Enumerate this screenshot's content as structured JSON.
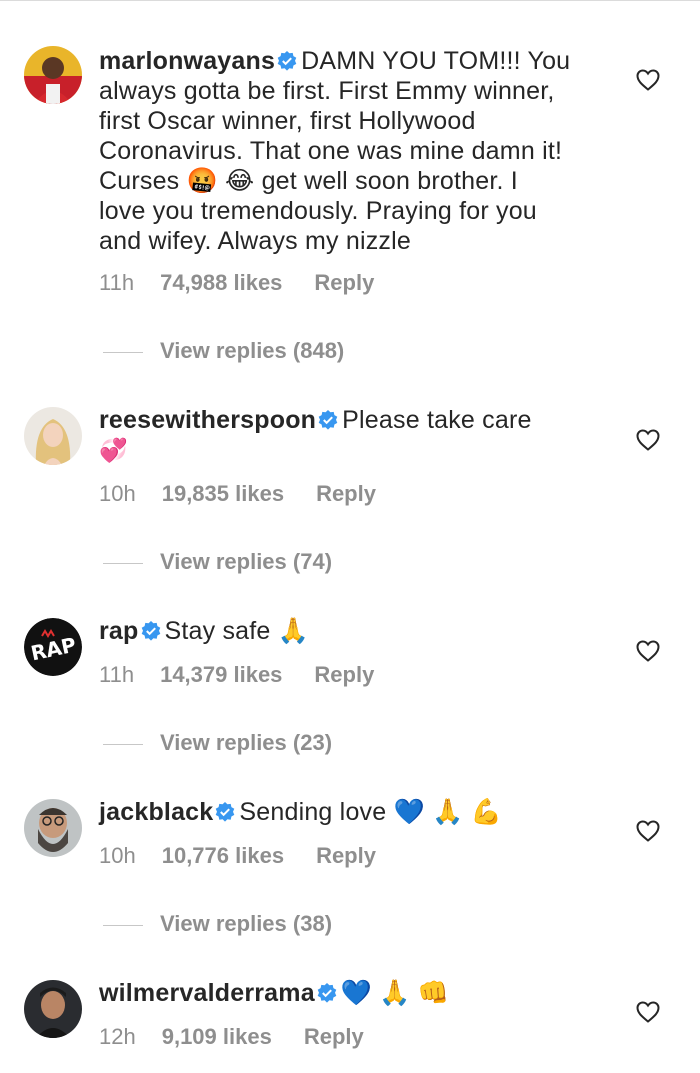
{
  "comments": [
    {
      "username": "marlonwayans",
      "text_lines": [
        "DAMN YOU TOM!!! You",
        "always gotta be first. First Emmy winner,",
        "first Oscar winner, first Hollywood",
        "Coronavirus. That one was mine damn it!",
        "Curses 🤬 😂 get well soon brother. I",
        "love you tremendously. Praying for you",
        "and wifey. Always my nizzle"
      ],
      "time": "11h",
      "likes": "74,988 likes",
      "reply": "Reply",
      "view_replies": "View replies (848)",
      "avatar": "avatar-marlonwayans"
    },
    {
      "username": "reesewitherspoon",
      "text_lines": [
        "Please take care",
        "💞"
      ],
      "time": "10h",
      "likes": "19,835 likes",
      "reply": "Reply",
      "view_replies": "View replies (74)",
      "avatar": "avatar-reesewitherspoon"
    },
    {
      "username": "rap",
      "text_lines": [
        "Stay safe 🙏"
      ],
      "time": "11h",
      "likes": "14,379 likes",
      "reply": "Reply",
      "view_replies": "View replies (23)",
      "avatar": "avatar-rap"
    },
    {
      "username": "jackblack",
      "text_lines": [
        "Sending love 💙 🙏 💪"
      ],
      "time": "10h",
      "likes": "10,776 likes",
      "reply": "Reply",
      "view_replies": "View replies (38)",
      "avatar": "avatar-jackblack"
    },
    {
      "username": "wilmervalderrama",
      "text_lines": [
        "💙 🙏 👊"
      ],
      "time": "12h",
      "likes": "9,109 likes",
      "reply": "Reply",
      "avatar": "avatar-wilmervalderrama"
    }
  ],
  "colors": {
    "text": "#262626",
    "secondary": "#8e8e8e",
    "verified": "#3897f0",
    "divider": "#c7c7c7"
  },
  "icons": {
    "verified": "verified-badge-icon",
    "like": "heart-outline-icon"
  }
}
